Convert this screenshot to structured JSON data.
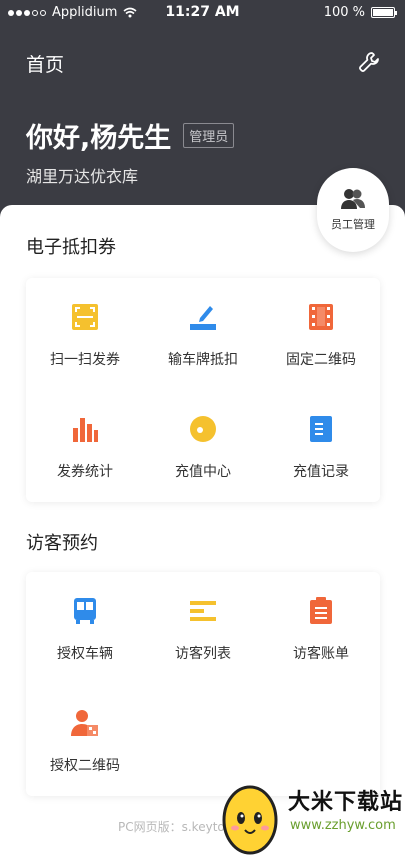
{
  "status_bar": {
    "carrier": "Applidium",
    "time": "11:27 AM",
    "battery": "100 %"
  },
  "header": {
    "title": "首页",
    "greeting": "你好,杨先生",
    "role": "管理员",
    "store": "湖里万达优衣库"
  },
  "staff_button": {
    "label": "员工管理"
  },
  "coupons": {
    "title": "电子抵扣券",
    "items": [
      {
        "label": "扫一扫发券",
        "icon": "scan-icon",
        "color": "#f5c12e"
      },
      {
        "label": "输车牌抵扣",
        "icon": "edit-plate-icon",
        "color": "#2f8bea"
      },
      {
        "label": "固定二维码",
        "icon": "film-qr-icon",
        "color": "#f0673a"
      },
      {
        "label": "发券统计",
        "icon": "bar-chart-icon",
        "color": "#f0673a"
      },
      {
        "label": "充值中心",
        "icon": "coin-icon",
        "color": "#f5c12e"
      },
      {
        "label": "充值记录",
        "icon": "record-doc-icon",
        "color": "#2f8bea"
      }
    ]
  },
  "visitors": {
    "title": "访客预约",
    "items": [
      {
        "label": "授权车辆",
        "icon": "bus-icon",
        "color": "#2f8bea"
      },
      {
        "label": "访客列表",
        "icon": "list-icon",
        "color": "#f5c12e"
      },
      {
        "label": "访客账单",
        "icon": "clipboard-icon",
        "color": "#f0673a"
      },
      {
        "label": "授权二维码",
        "icon": "user-qr-icon",
        "color": "#f0673a"
      }
    ]
  },
  "footer": {
    "text": "PC网页版：s.keytop"
  },
  "watermark": {
    "title": "大米下载站",
    "url": "www.zzhyw.com"
  }
}
